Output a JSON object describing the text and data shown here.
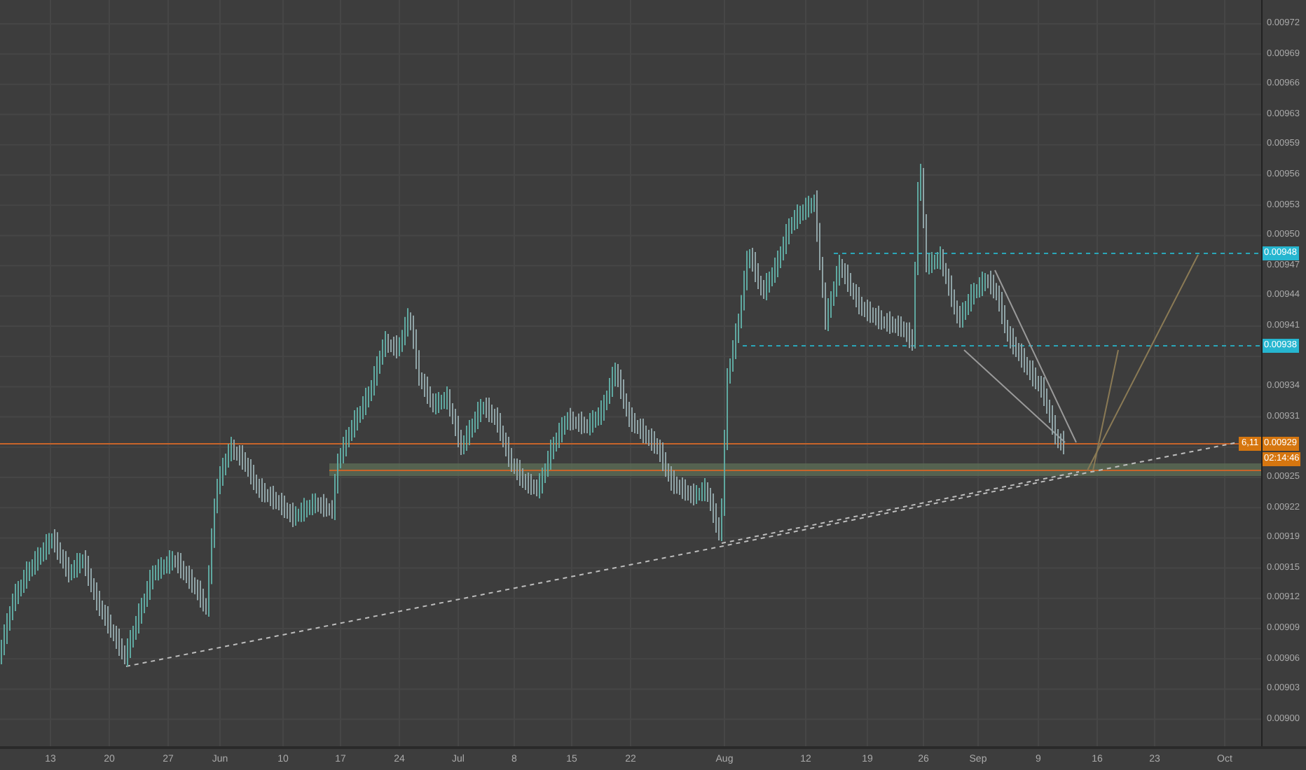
{
  "price_axis": {
    "labels": [
      "0.00972",
      "0.00969",
      "0.00966",
      "0.00963",
      "0.00959",
      "0.00956",
      "0.00953",
      "0.00950",
      "0.00947",
      "0.00944",
      "0.00941",
      "0.00934",
      "0.00931",
      "0.00925",
      "0.00922",
      "0.00919",
      "0.00915",
      "0.00912",
      "0.00909",
      "0.00906",
      "0.00903",
      "0.00900"
    ]
  },
  "time_axis": {
    "labels": [
      "13",
      "20",
      "27",
      "Jun",
      "10",
      "17",
      "24",
      "Jul",
      "8",
      "15",
      "22",
      "Aug",
      "12",
      "19",
      "26",
      "Sep",
      "9",
      "16",
      "23",
      "Oct"
    ]
  },
  "price_badges": [
    {
      "text": "0.00948",
      "color": "#26b6d0"
    },
    {
      "text": "0.00938",
      "color": "#26b6d0"
    },
    {
      "text": "0.00929",
      "color": "#d6760f"
    }
  ],
  "symbol_badge": {
    "text": "6,11",
    "color": "#d6760f"
  },
  "countdown": {
    "text": "02:14:46",
    "color": "#d6760f"
  }
}
